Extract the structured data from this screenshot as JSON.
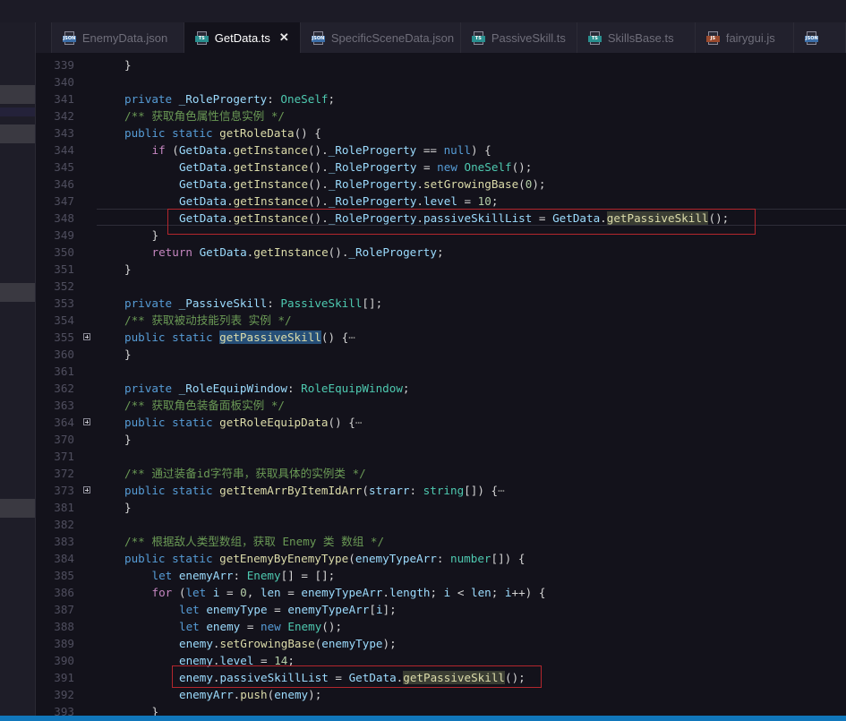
{
  "tabs": [
    {
      "label": "EnemyData.json",
      "icon": "json-file-icon",
      "icon_text": "JSON",
      "icon_color": "#3d6fa8",
      "active": false
    },
    {
      "label": "GetData.ts",
      "icon": "typescript-file-icon",
      "icon_text": "TS",
      "icon_color": "#2a8f8f",
      "active": true,
      "close": "✕"
    },
    {
      "label": "SpecificSceneData.json",
      "icon": "json-file-icon",
      "icon_text": "JSON",
      "icon_color": "#3d6fa8",
      "active": false
    },
    {
      "label": "PassiveSkill.ts",
      "icon": "typescript-file-icon",
      "icon_text": "TS",
      "icon_color": "#2a8f8f",
      "active": false
    },
    {
      "label": "SkillsBase.ts",
      "icon": "typescript-file-icon",
      "icon_text": "TS",
      "icon_color": "#2a8f8f",
      "active": false
    },
    {
      "label": "fairygui.js",
      "icon": "javascript-file-icon",
      "icon_text": "JS",
      "icon_color": "#9a4a2e",
      "active": false
    },
    {
      "label": "",
      "icon": "json-file-icon",
      "icon_text": "JSON",
      "icon_color": "#3d6fa8",
      "active": false
    }
  ],
  "editor": {
    "lines": [
      {
        "n": "339",
        "indent": 0,
        "tokens": [
          [
            "p",
            "}"
          ]
        ]
      },
      {
        "n": "340",
        "indent": 0,
        "tokens": []
      },
      {
        "n": "341",
        "indent": 0,
        "tokens": [
          [
            "k",
            "private "
          ],
          [
            "v",
            "_RoleProgerty"
          ],
          [
            "p",
            ": "
          ],
          [
            "t",
            "OneSelf"
          ],
          [
            "p",
            ";"
          ]
        ]
      },
      {
        "n": "342",
        "indent": 0,
        "tokens": [
          [
            "c",
            "/** 获取角色属性信息实例 */"
          ]
        ]
      },
      {
        "n": "343",
        "indent": 0,
        "tokens": [
          [
            "k",
            "public "
          ],
          [
            "k",
            "static "
          ],
          [
            "f",
            "getRoleData"
          ],
          [
            "p",
            "() {"
          ]
        ]
      },
      {
        "n": "344",
        "indent": 1,
        "tokens": [
          [
            "kc",
            "if "
          ],
          [
            "p",
            "("
          ],
          [
            "v",
            "GetData"
          ],
          [
            "p",
            "."
          ],
          [
            "f",
            "getInstance"
          ],
          [
            "p",
            "()."
          ],
          [
            "v",
            "_RoleProgerty"
          ],
          [
            "p",
            " == "
          ],
          [
            "k",
            "null"
          ],
          [
            "p",
            ") {"
          ]
        ]
      },
      {
        "n": "345",
        "indent": 2,
        "tokens": [
          [
            "v",
            "GetData"
          ],
          [
            "p",
            "."
          ],
          [
            "f",
            "getInstance"
          ],
          [
            "p",
            "()."
          ],
          [
            "v",
            "_RoleProgerty"
          ],
          [
            "p",
            " = "
          ],
          [
            "k",
            "new "
          ],
          [
            "t",
            "OneSelf"
          ],
          [
            "p",
            "();"
          ]
        ]
      },
      {
        "n": "346",
        "indent": 2,
        "tokens": [
          [
            "v",
            "GetData"
          ],
          [
            "p",
            "."
          ],
          [
            "f",
            "getInstance"
          ],
          [
            "p",
            "()."
          ],
          [
            "v",
            "_RoleProgerty"
          ],
          [
            "p",
            "."
          ],
          [
            "f",
            "setGrowingBase"
          ],
          [
            "p",
            "("
          ],
          [
            "n",
            "0"
          ],
          [
            "p",
            ");"
          ]
        ]
      },
      {
        "n": "347",
        "indent": 2,
        "tokens": [
          [
            "v",
            "GetData"
          ],
          [
            "p",
            "."
          ],
          [
            "f",
            "getInstance"
          ],
          [
            "p",
            "()."
          ],
          [
            "v",
            "_RoleProgerty"
          ],
          [
            "p",
            "."
          ],
          [
            "v",
            "level"
          ],
          [
            "p",
            " = "
          ],
          [
            "n",
            "10"
          ],
          [
            "p",
            ";"
          ]
        ]
      },
      {
        "n": "348",
        "indent": 2,
        "tokens": [
          [
            "v",
            "GetData"
          ],
          [
            "p",
            "."
          ],
          [
            "f",
            "getInstance"
          ],
          [
            "p",
            "()."
          ],
          [
            "v",
            "_RoleProgerty"
          ],
          [
            "p",
            "."
          ],
          [
            "v",
            "passiveSkillList"
          ],
          [
            "p",
            " = "
          ],
          [
            "v",
            "GetData"
          ],
          [
            "p",
            "."
          ],
          [
            "f hlword",
            "getPassiveSkill"
          ],
          [
            "p",
            "();"
          ]
        ]
      },
      {
        "n": "349",
        "indent": 1,
        "tokens": [
          [
            "p",
            "}"
          ]
        ]
      },
      {
        "n": "350",
        "indent": 1,
        "tokens": [
          [
            "kc",
            "return "
          ],
          [
            "v",
            "GetData"
          ],
          [
            "p",
            "."
          ],
          [
            "f",
            "getInstance"
          ],
          [
            "p",
            "()."
          ],
          [
            "v",
            "_RoleProgerty"
          ],
          [
            "p",
            ";"
          ]
        ]
      },
      {
        "n": "351",
        "indent": 0,
        "tokens": [
          [
            "p",
            "}"
          ]
        ]
      },
      {
        "n": "352",
        "indent": 0,
        "tokens": []
      },
      {
        "n": "353",
        "indent": 0,
        "tokens": [
          [
            "k",
            "private "
          ],
          [
            "v",
            "_PassiveSkill"
          ],
          [
            "p",
            ": "
          ],
          [
            "t",
            "PassiveSkill"
          ],
          [
            "p",
            "[];"
          ]
        ]
      },
      {
        "n": "354",
        "indent": 0,
        "tokens": [
          [
            "c",
            "/** 获取被动技能列表 实例 */"
          ]
        ]
      },
      {
        "n": "355",
        "indent": 0,
        "fold": true,
        "tokens": [
          [
            "k",
            "public "
          ],
          [
            "k",
            "static "
          ],
          [
            "f selword",
            "getPassiveSkill"
          ],
          [
            "p",
            "() {"
          ],
          [
            "ell",
            "⋯"
          ]
        ]
      },
      {
        "n": "360",
        "indent": 0,
        "tokens": [
          [
            "p",
            "}"
          ]
        ]
      },
      {
        "n": "361",
        "indent": 0,
        "tokens": []
      },
      {
        "n": "362",
        "indent": 0,
        "tokens": [
          [
            "k",
            "private "
          ],
          [
            "v",
            "_RoleEquipWindow"
          ],
          [
            "p",
            ": "
          ],
          [
            "t",
            "RoleEquipWindow"
          ],
          [
            "p",
            ";"
          ]
        ]
      },
      {
        "n": "363",
        "indent": 0,
        "tokens": [
          [
            "c",
            "/** 获取角色装备面板实例 */"
          ]
        ]
      },
      {
        "n": "364",
        "indent": 0,
        "fold": true,
        "tokens": [
          [
            "k",
            "public "
          ],
          [
            "k",
            "static "
          ],
          [
            "f",
            "getRoleEquipData"
          ],
          [
            "p",
            "() {"
          ],
          [
            "ell",
            "⋯"
          ]
        ]
      },
      {
        "n": "370",
        "indent": 0,
        "tokens": [
          [
            "p",
            "}"
          ]
        ]
      },
      {
        "n": "371",
        "indent": 0,
        "tokens": []
      },
      {
        "n": "372",
        "indent": 0,
        "tokens": [
          [
            "c",
            "/** 通过装备id字符串，获取具体的实例类 */"
          ]
        ]
      },
      {
        "n": "373",
        "indent": 0,
        "fold": true,
        "tokens": [
          [
            "k",
            "public "
          ],
          [
            "k",
            "static "
          ],
          [
            "f",
            "getItemArrByItemIdArr"
          ],
          [
            "p",
            "("
          ],
          [
            "v",
            "strarr"
          ],
          [
            "p",
            ": "
          ],
          [
            "t",
            "string"
          ],
          [
            "p",
            "[]) {"
          ],
          [
            "ell",
            "⋯"
          ]
        ]
      },
      {
        "n": "381",
        "indent": 0,
        "tokens": [
          [
            "p",
            "}"
          ]
        ]
      },
      {
        "n": "382",
        "indent": 0,
        "tokens": []
      },
      {
        "n": "383",
        "indent": 0,
        "tokens": [
          [
            "c",
            "/** 根据敌人类型数组，获取 Enemy 类 数组 */"
          ]
        ]
      },
      {
        "n": "384",
        "indent": 0,
        "tokens": [
          [
            "k",
            "public "
          ],
          [
            "k",
            "static "
          ],
          [
            "f",
            "getEnemyByEnemyType"
          ],
          [
            "p",
            "("
          ],
          [
            "v",
            "enemyTypeArr"
          ],
          [
            "p",
            ": "
          ],
          [
            "t",
            "number"
          ],
          [
            "p",
            "[]) {"
          ]
        ]
      },
      {
        "n": "385",
        "indent": 1,
        "tokens": [
          [
            "k",
            "let "
          ],
          [
            "v",
            "enemyArr"
          ],
          [
            "p",
            ": "
          ],
          [
            "t",
            "Enemy"
          ],
          [
            "p",
            "[] = [];"
          ]
        ]
      },
      {
        "n": "386",
        "indent": 1,
        "tokens": [
          [
            "kc",
            "for "
          ],
          [
            "p",
            "("
          ],
          [
            "k",
            "let "
          ],
          [
            "v",
            "i"
          ],
          [
            "p",
            " = "
          ],
          [
            "n",
            "0"
          ],
          [
            "p",
            ", "
          ],
          [
            "v",
            "len"
          ],
          [
            "p",
            " = "
          ],
          [
            "v",
            "enemyTypeArr"
          ],
          [
            "p",
            "."
          ],
          [
            "v",
            "length"
          ],
          [
            "p",
            "; "
          ],
          [
            "v",
            "i"
          ],
          [
            "p",
            " < "
          ],
          [
            "v",
            "len"
          ],
          [
            "p",
            "; "
          ],
          [
            "v",
            "i"
          ],
          [
            "p",
            "++) {"
          ]
        ]
      },
      {
        "n": "387",
        "indent": 2,
        "tokens": [
          [
            "k",
            "let "
          ],
          [
            "v",
            "enemyType"
          ],
          [
            "p",
            " = "
          ],
          [
            "v",
            "enemyTypeArr"
          ],
          [
            "p",
            "["
          ],
          [
            "v",
            "i"
          ],
          [
            "p",
            "];"
          ]
        ]
      },
      {
        "n": "388",
        "indent": 2,
        "tokens": [
          [
            "k",
            "let "
          ],
          [
            "v",
            "enemy"
          ],
          [
            "p",
            " = "
          ],
          [
            "k",
            "new "
          ],
          [
            "t",
            "Enemy"
          ],
          [
            "p",
            "();"
          ]
        ]
      },
      {
        "n": "389",
        "indent": 2,
        "tokens": [
          [
            "v",
            "enemy"
          ],
          [
            "p",
            "."
          ],
          [
            "f",
            "setGrowingBase"
          ],
          [
            "p",
            "("
          ],
          [
            "v",
            "enemyType"
          ],
          [
            "p",
            ");"
          ]
        ]
      },
      {
        "n": "390",
        "indent": 2,
        "tokens": [
          [
            "v",
            "enemy"
          ],
          [
            "p",
            "."
          ],
          [
            "v",
            "level"
          ],
          [
            "p",
            " = "
          ],
          [
            "n",
            "14"
          ],
          [
            "p",
            ";"
          ]
        ]
      },
      {
        "n": "391",
        "indent": 2,
        "tokens": [
          [
            "v",
            "enemy"
          ],
          [
            "p",
            "."
          ],
          [
            "v",
            "passiveSkillList"
          ],
          [
            "p",
            " = "
          ],
          [
            "v",
            "GetData"
          ],
          [
            "p",
            "."
          ],
          [
            "f hlword",
            "getPassiveSkill"
          ],
          [
            "p",
            "();"
          ]
        ]
      },
      {
        "n": "392",
        "indent": 2,
        "tokens": [
          [
            "v",
            "enemyArr"
          ],
          [
            "p",
            "."
          ],
          [
            "f",
            "push"
          ],
          [
            "p",
            "("
          ],
          [
            "v",
            "enemy"
          ],
          [
            "p",
            ");"
          ]
        ]
      },
      {
        "n": "393",
        "indent": 1,
        "tokens": [
          [
            "p",
            "}"
          ]
        ]
      }
    ]
  },
  "annotations": [
    {
      "label": "highlight-box-line-348",
      "color": "#b3262d"
    },
    {
      "label": "highlight-box-line-391",
      "color": "#b3262d"
    }
  ],
  "colors": {
    "accent_statusbar": "#1177bb",
    "editor_background": "#13121b",
    "annotation_red": "#b3262d"
  }
}
